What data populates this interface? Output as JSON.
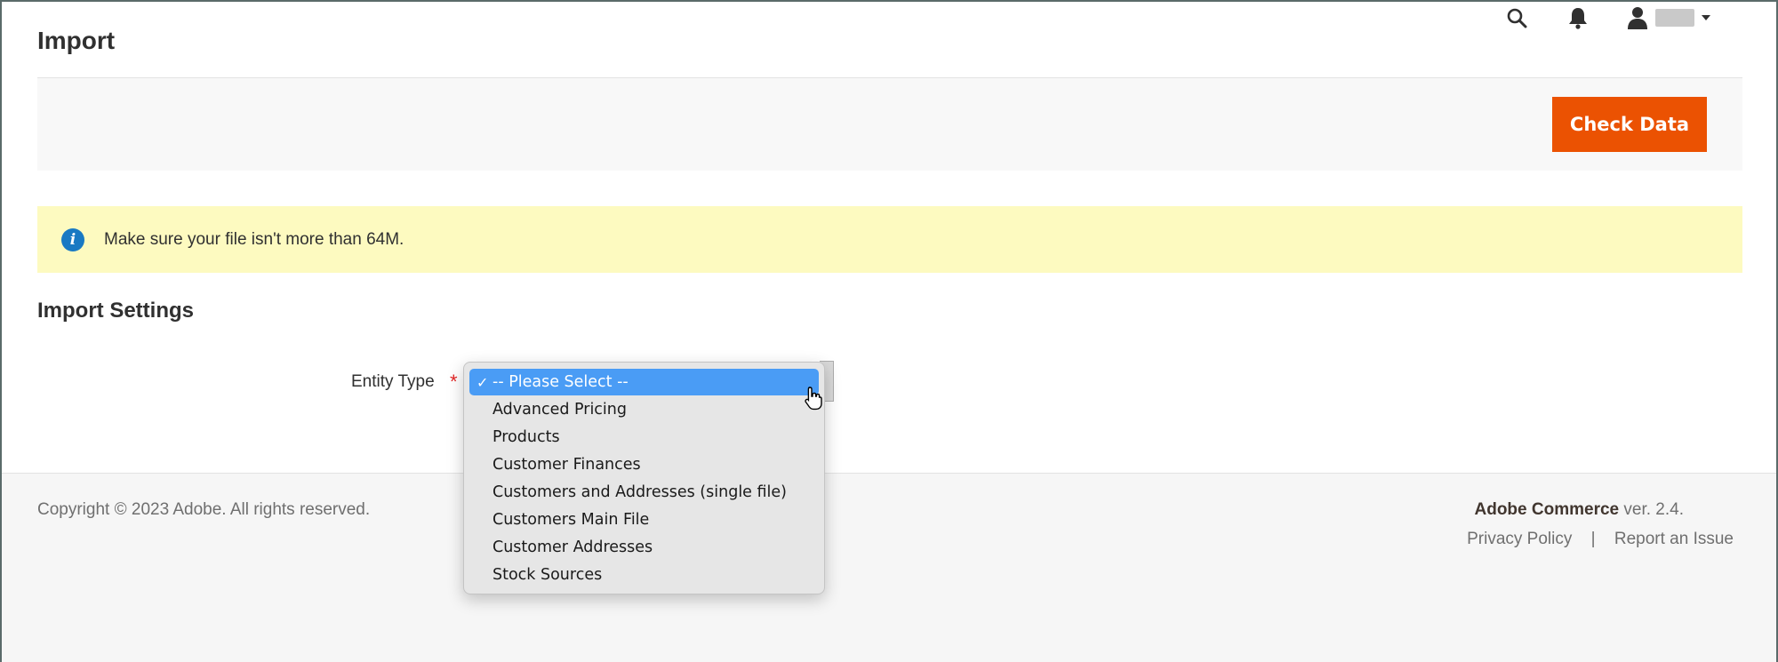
{
  "header": {
    "title": "Import",
    "icons": [
      "search-icon",
      "bell-icon",
      "user-icon"
    ]
  },
  "action_bar": {
    "check_data_label": "Check Data"
  },
  "notice": {
    "icon": "info-icon",
    "text": "Make sure your file isn't more than 64M."
  },
  "settings": {
    "section_title": "Import Settings",
    "entity_type_label": "Entity Type",
    "required_marker": "*",
    "dropdown": {
      "selected": "-- Please Select --",
      "check_glyph": "✓",
      "options": [
        "-- Please Select --",
        "Advanced Pricing",
        "Products",
        "Customer Finances",
        "Customers and Addresses (single file)",
        "Customers Main File",
        "Customer Addresses",
        "Stock Sources"
      ]
    }
  },
  "footer": {
    "copyright": "Copyright © 2023 Adobe. All rights reserved.",
    "product_name": "Adobe Commerce",
    "version": "ver. 2.4.",
    "privacy_policy": "Privacy Policy",
    "separator": "|",
    "report_issue": "Report an Issue"
  },
  "colors": {
    "accent": "#eb5202",
    "notice_bg": "#fdfac0",
    "info_blue": "#1979c3",
    "selection_blue": "#4a9cf5",
    "required_red": "#e22626"
  }
}
